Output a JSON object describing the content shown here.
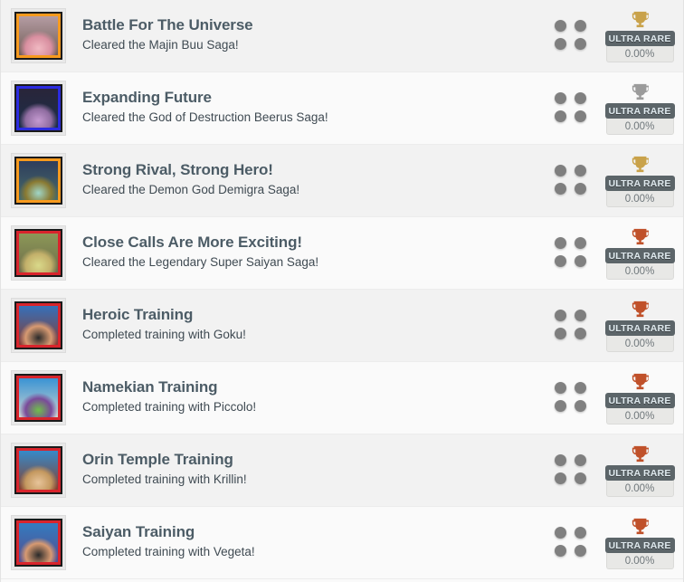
{
  "list": {
    "rarity_label": "ULTRA RARE",
    "percent": "0.00%",
    "rows": [
      {
        "title": "Battle For The Universe",
        "description": "Cleared the Majin Buu Saga!",
        "rarity": "ULTRA RARE",
        "percent": "0.00%",
        "trophy_type": "gold-trophy-icon",
        "trophy_color": "#c9a24a",
        "icon_name": "achievement-icon-kid-buu",
        "frame_color": "#f79a1e",
        "art_top": "#b9a0a8",
        "art_bottom": "#6d5a52",
        "char_color": "#f0b9c2",
        "char_shade": "#d98fa0"
      },
      {
        "title": "Expanding Future",
        "description": "Cleared the God of Destruction Beerus Saga!",
        "rarity": "ULTRA RARE",
        "percent": "0.00%",
        "trophy_type": "silver-trophy-icon",
        "trophy_color": "#9b9b9b",
        "icon_name": "achievement-icon-beerus",
        "frame_color": "#2b2be0",
        "art_top": "#2a2438",
        "art_bottom": "#1b2f4a",
        "char_color": "#c49ad0",
        "char_shade": "#8f6ca0"
      },
      {
        "title": "Strong Rival, Strong Hero!",
        "description": "Cleared the Demon God Demigra Saga!",
        "rarity": "ULTRA RARE",
        "percent": "0.00%",
        "trophy_type": "gold-trophy-icon",
        "trophy_color": "#c9a24a",
        "icon_name": "achievement-icon-demigra",
        "frame_color": "#f79a1e",
        "art_top": "#2c3a5c",
        "art_bottom": "#4a6f6a",
        "char_color": "#9fd6c8",
        "char_shade": "#8a7a32"
      },
      {
        "title": "Close Calls Are More Exciting!",
        "description": "Cleared the Legendary Super Saiyan Saga!",
        "rarity": "ULTRA RARE",
        "percent": "0.00%",
        "trophy_type": "bronze-trophy-icon",
        "trophy_color": "#c0512a",
        "icon_name": "achievement-icon-broly",
        "frame_color": "#d8242c",
        "art_top": "#8e9a58",
        "art_bottom": "#6c6a4a",
        "char_color": "#d9d98a",
        "char_shade": "#c3b06a"
      },
      {
        "title": "Heroic Training",
        "description": "Completed training with Goku!",
        "rarity": "ULTRA RARE",
        "percent": "0.00%",
        "trophy_type": "bronze-trophy-icon",
        "trophy_color": "#c0512a",
        "icon_name": "achievement-icon-goku",
        "frame_color": "#d8242c",
        "art_top": "#2f74c4",
        "art_bottom": "#8d3a2a",
        "char_color": "#2a2a2a",
        "char_shade": "#d79a72"
      },
      {
        "title": "Namekian Training",
        "description": "Completed training with Piccolo!",
        "rarity": "ULTRA RARE",
        "percent": "0.00%",
        "trophy_type": "bronze-trophy-icon",
        "trophy_color": "#c0512a",
        "icon_name": "achievement-icon-piccolo",
        "frame_color": "#d8242c",
        "art_top": "#2f8fd4",
        "art_bottom": "#d8d8d0",
        "char_color": "#6fbf4a",
        "char_shade": "#7a4a9a"
      },
      {
        "title": "Orin Temple Training",
        "description": "Completed training with Krillin!",
        "rarity": "ULTRA RARE",
        "percent": "0.00%",
        "trophy_type": "bronze-trophy-icon",
        "trophy_color": "#c0512a",
        "icon_name": "achievement-icon-krillin",
        "frame_color": "#d8242c",
        "art_top": "#2f8fd4",
        "art_bottom": "#8d3a22",
        "char_color": "#e7c49a",
        "char_shade": "#c4985f"
      },
      {
        "title": "Saiyan Training",
        "description": "Completed training with Vegeta!",
        "rarity": "ULTRA RARE",
        "percent": "0.00%",
        "trophy_type": "bronze-trophy-icon",
        "trophy_color": "#c0512a",
        "icon_name": "achievement-icon-vegeta",
        "frame_color": "#d8242c",
        "art_top": "#2f7fc4",
        "art_bottom": "#5a4a8a",
        "char_color": "#2a2a2a",
        "char_shade": "#d79a72"
      }
    ]
  }
}
